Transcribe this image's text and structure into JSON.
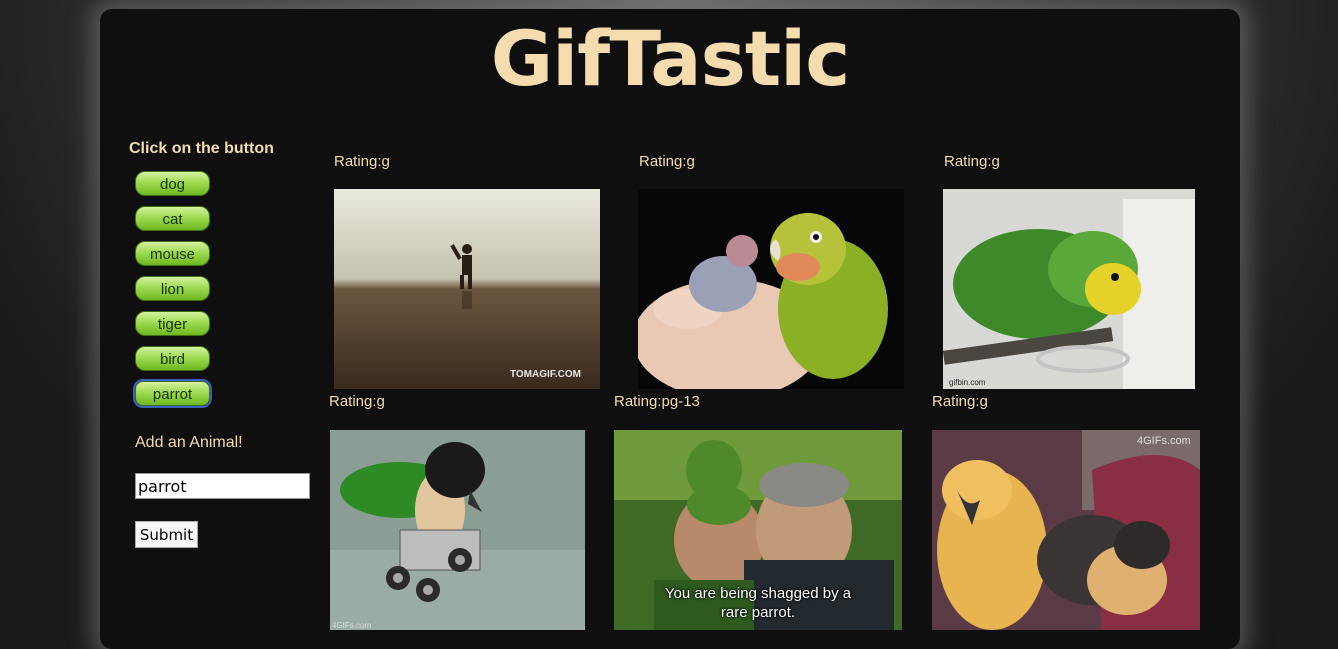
{
  "app": {
    "title": "GifTastic"
  },
  "sidebar": {
    "heading": "Click on the button",
    "buttons": [
      "dog",
      "cat",
      "mouse",
      "lion",
      "tiger",
      "bird",
      "parrot"
    ],
    "add_label": "Add an Animal!",
    "input_value": "parrot",
    "submit_label": "Submit"
  },
  "gifs": [
    {
      "rating": "Rating:g",
      "watermark": "TOMAGIF.COM"
    },
    {
      "rating": "Rating:g"
    },
    {
      "rating": "Rating:g",
      "watermark": "gifbin.com"
    },
    {
      "rating": "Rating:g",
      "watermark": "4GIFs.com"
    },
    {
      "rating": "Rating:pg-13",
      "caption_line1": "You are being shagged by a",
      "caption_line2": "rare parrot."
    },
    {
      "rating": "Rating:g",
      "watermark": "4GIFs.com"
    }
  ],
  "colors": {
    "accent": "#f5dcae",
    "button_green": "#9edb52",
    "panel": "#0f0f0f"
  }
}
